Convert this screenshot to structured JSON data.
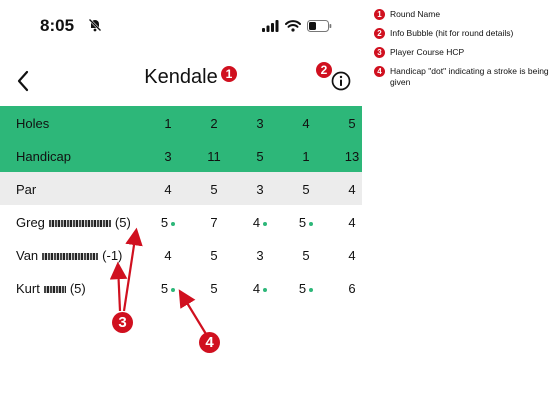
{
  "status_bar": {
    "time": "8:05"
  },
  "header": {
    "title": "Kendale"
  },
  "scorecard": {
    "holes_label": "Holes",
    "holes": [
      "1",
      "2",
      "3",
      "4",
      "5"
    ],
    "handicap_label": "Handicap",
    "handicaps": [
      "3",
      "11",
      "5",
      "1",
      "13"
    ],
    "par_label": "Par",
    "pars": [
      "4",
      "5",
      "3",
      "5",
      "4"
    ],
    "players": [
      {
        "first_name": "Greg",
        "course_hcp": "(5)",
        "scores": [
          "5",
          "7",
          "4",
          "5",
          "4"
        ],
        "stroke_dots": [
          true,
          false,
          true,
          true,
          false
        ]
      },
      {
        "first_name": "Van",
        "course_hcp": "(-1)",
        "scores": [
          "4",
          "5",
          "3",
          "5",
          "4"
        ],
        "stroke_dots": [
          false,
          false,
          false,
          false,
          false
        ]
      },
      {
        "first_name": "Kurt",
        "course_hcp": "(5)",
        "scores": [
          "5",
          "5",
          "4",
          "5",
          "6"
        ],
        "stroke_dots": [
          true,
          false,
          true,
          true,
          false
        ]
      }
    ]
  },
  "annotations": [
    {
      "number": "1",
      "text": "Round Name"
    },
    {
      "number": "2",
      "text": "Info Bubble (hit for round details)"
    },
    {
      "number": "3",
      "text": "Player Course HCP"
    },
    {
      "number": "4",
      "text": "Handicap \"dot\" indicating a stroke is being given"
    }
  ],
  "colors": {
    "header_green": "#2db779",
    "par_gray": "#ececec",
    "annotation_red": "#d0101f",
    "dot_green": "#2db779"
  },
  "icons": {
    "back": "chevron-left-icon",
    "info": "info-circle-icon",
    "bell": "bell-slash-icon"
  }
}
